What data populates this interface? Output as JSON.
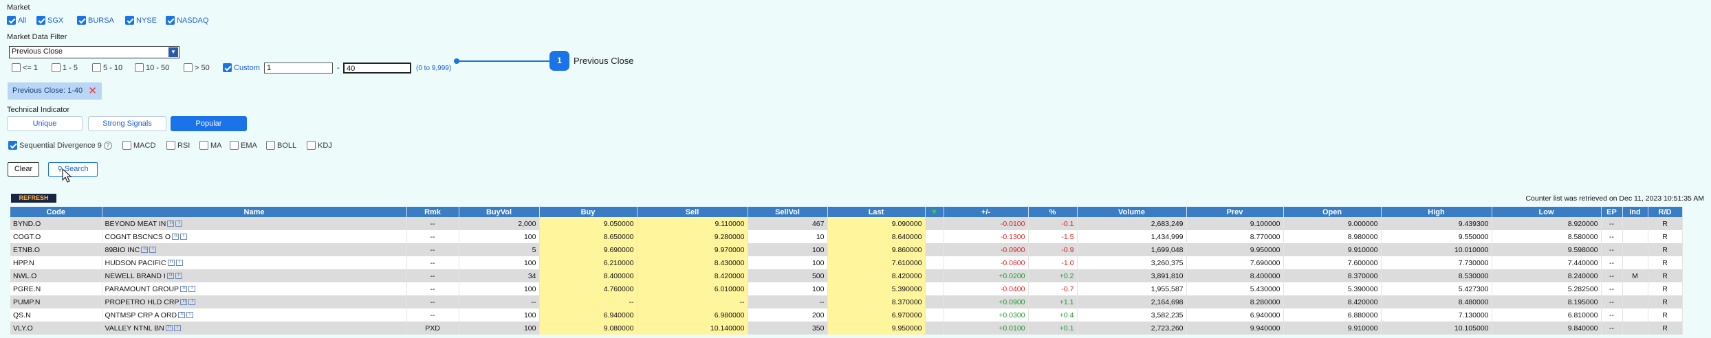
{
  "market": {
    "title": "Market",
    "options": [
      {
        "label": "All",
        "checked": true
      },
      {
        "label": "SGX",
        "checked": true
      },
      {
        "label": "BURSA",
        "checked": true
      },
      {
        "label": "NYSE",
        "checked": true
      },
      {
        "label": "NASDAQ",
        "checked": true
      }
    ]
  },
  "filter": {
    "title": "Market Data Filter",
    "selected": "Previous Close",
    "ranges": [
      {
        "label": "<= 1",
        "checked": false
      },
      {
        "label": "1 - 5",
        "checked": false
      },
      {
        "label": "5 - 10",
        "checked": false
      },
      {
        "label": "10 - 50",
        "checked": false
      },
      {
        "label": "> 50",
        "checked": false
      }
    ],
    "custom": {
      "label": "Custom",
      "checked": true,
      "from": "1",
      "sep": "-",
      "to": "40",
      "hint": "(0 to 9,999)"
    },
    "chip": "Previous Close: 1-40",
    "chip_close": "✕"
  },
  "callout": {
    "number": "1",
    "text": "Previous Close"
  },
  "technical": {
    "title": "Technical Indicator",
    "tabs": [
      {
        "label": "Unique",
        "active": false
      },
      {
        "label": "Strong Signals",
        "active": false
      },
      {
        "label": "Popular",
        "active": true
      }
    ],
    "indicators": [
      {
        "label": "Sequential Divergence 9",
        "checked": true
      },
      {
        "label": "MACD",
        "checked": false
      },
      {
        "label": "RSI",
        "checked": false
      },
      {
        "label": "MA",
        "checked": false
      },
      {
        "label": "EMA",
        "checked": false
      },
      {
        "label": "BOLL",
        "checked": false
      },
      {
        "label": "KDJ",
        "checked": false
      }
    ],
    "help": "?"
  },
  "actions": {
    "clear": "Clear",
    "search": "Search"
  },
  "refresh": "REFRESH",
  "retrieved": "Counter list was retrieved on Dec 11, 2023 10:51:35 AM",
  "table": {
    "columns": [
      "Code",
      "Name",
      "Rmk",
      "BuyVol",
      "Buy",
      "Sell",
      "SellVol",
      "Last",
      "▼",
      "+/-",
      "%",
      "Volume",
      "Prev",
      "Open",
      "High",
      "Low",
      "EP",
      "Ind",
      "R/D"
    ],
    "rows": [
      [
        "BYND.O",
        "BEYOND MEAT IN",
        "--",
        "2,000",
        "9.050000",
        "9.110000",
        "467",
        "9.090000",
        "",
        "-0.0100",
        "-0.1",
        "2,683,249",
        "9.100000",
        "9.000000",
        "9.439300",
        "8.920000",
        "--",
        "",
        "R"
      ],
      [
        "COGT.O",
        "COGNT BSCNCS O",
        "--",
        "100",
        "8.650000",
        "9.280000",
        "10",
        "8.640000",
        "",
        "-0.1300",
        "-1.5",
        "1,434,999",
        "8.770000",
        "8.980000",
        "9.550000",
        "8.580000",
        "--",
        "",
        "R"
      ],
      [
        "ETNB.O",
        "89BIO INC",
        "--",
        "5",
        "9.690000",
        "9.970000",
        "100",
        "9.860000",
        "",
        "-0.0900",
        "-0.9",
        "1,699,048",
        "9.950000",
        "9.910000",
        "10.010000",
        "9.598000",
        "--",
        "",
        "R"
      ],
      [
        "HPP.N",
        "HUDSON PACIFIC",
        "--",
        "100",
        "6.210000",
        "8.430000",
        "100",
        "7.610000",
        "",
        "-0.0800",
        "-1.0",
        "3,260,375",
        "7.690000",
        "7.600000",
        "7.730000",
        "7.440000",
        "--",
        "",
        "R"
      ],
      [
        "NWL.O",
        "NEWELL BRAND I",
        "--",
        "34",
        "8.400000",
        "8.420000",
        "500",
        "8.420000",
        "",
        "+0.0200",
        "+0.2",
        "3,891,810",
        "8.400000",
        "8.370000",
        "8.530000",
        "8.240000",
        "--",
        "M",
        "R"
      ],
      [
        "PGRE.N",
        "PARAMOUNT GROUP",
        "--",
        "100",
        "4.760000",
        "6.010000",
        "100",
        "5.390000",
        "",
        "-0.0400",
        "-0.7",
        "1,955,587",
        "5.430000",
        "5.390000",
        "5.427300",
        "5.282500",
        "--",
        "",
        "R"
      ],
      [
        "PUMP.N",
        "PROPETRO HLD CRP",
        "--",
        "--",
        "--",
        "--",
        "--",
        "8.370000",
        "",
        "+0.0900",
        "+1.1",
        "2,164,698",
        "8.280000",
        "8.420000",
        "8.480000",
        "8.195000",
        "--",
        "",
        "R"
      ],
      [
        "QS.N",
        "QNTMSP CRP A ORD",
        "--",
        "100",
        "6.940000",
        "6.980000",
        "200",
        "6.970000",
        "",
        "+0.0300",
        "+0.4",
        "3,582,235",
        "6.940000",
        "6.880000",
        "7.130000",
        "6.810000",
        "--",
        "",
        "R"
      ],
      [
        "VLY.O",
        "VALLEY NTNL BN",
        "PXD",
        "100",
        "9.080000",
        "10.140000",
        "350",
        "9.950000",
        "",
        "+0.0100",
        "+0.1",
        "2,723,260",
        "9.940000",
        "9.910000",
        "10.105000",
        "9.840000",
        "--",
        "",
        "R"
      ]
    ]
  }
}
